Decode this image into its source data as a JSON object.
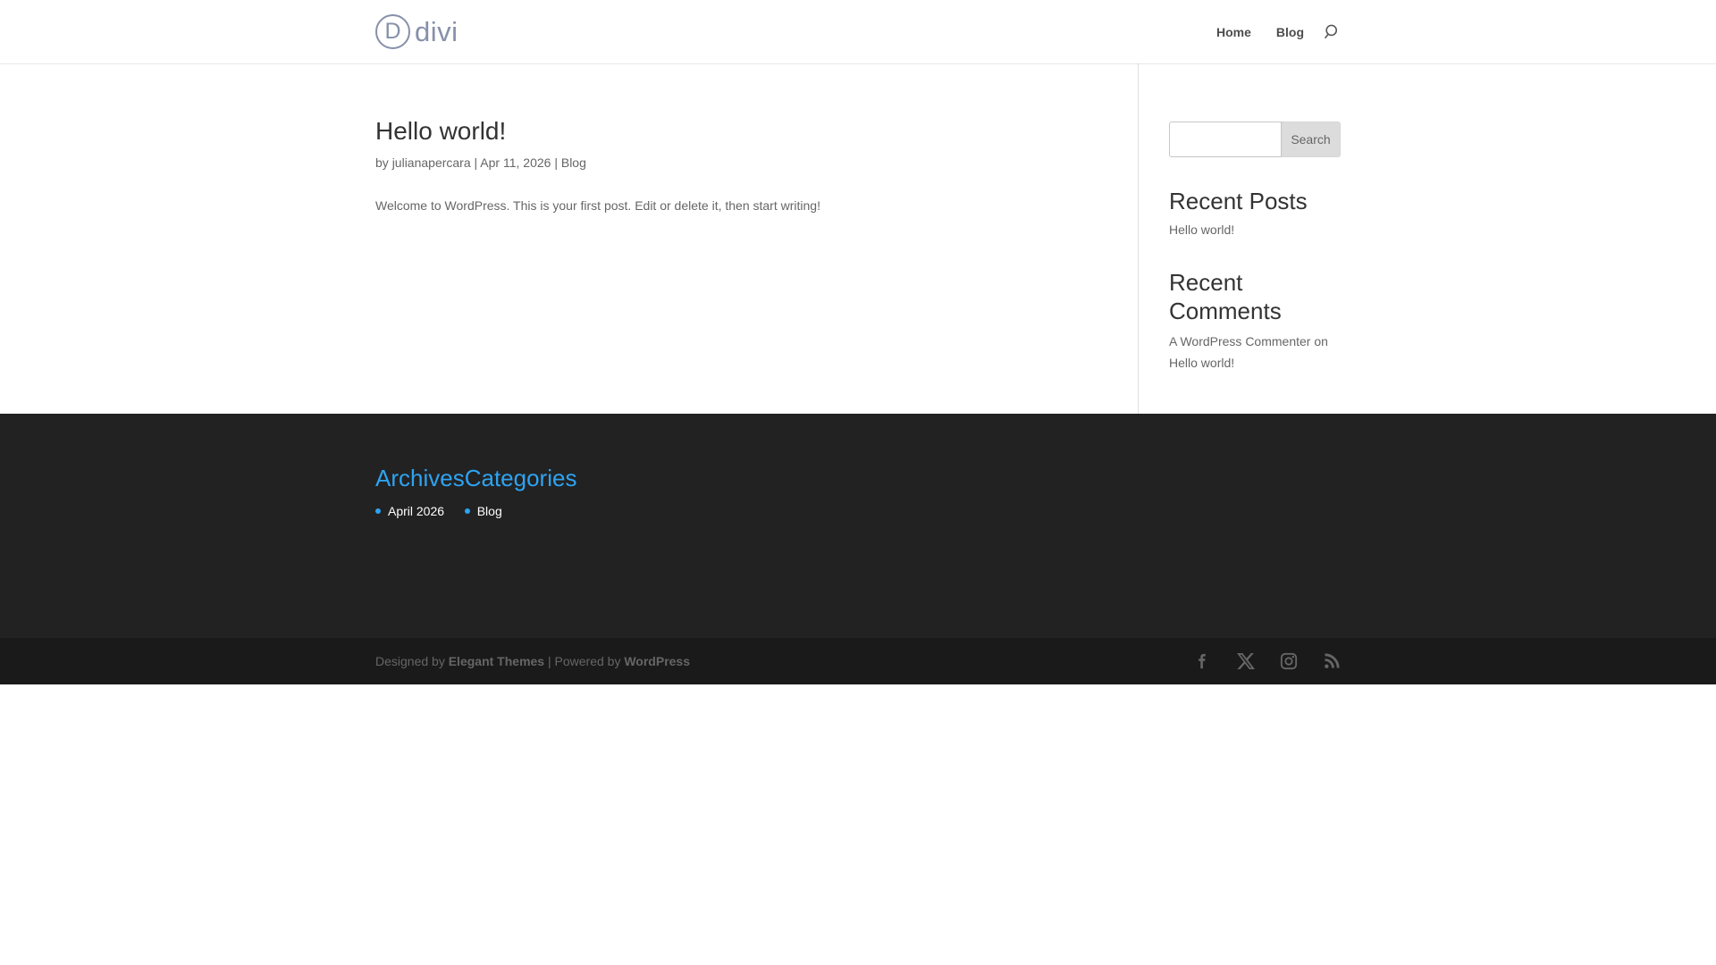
{
  "header": {
    "logo": {
      "circle_letter": "D",
      "wordmark": "divi"
    },
    "nav": [
      {
        "label": "Home"
      },
      {
        "label": "Blog"
      }
    ],
    "search_icon": "search-icon"
  },
  "post": {
    "title": "Hello world!",
    "meta": {
      "by_label": "by ",
      "author": "julianapercara",
      "sep1": " | ",
      "date": "Apr 11, 2026",
      "sep2": " | ",
      "category": "Blog"
    },
    "body": "Welcome to WordPress. This is your first post. Edit or delete it, then start writing!"
  },
  "sidebar": {
    "search": {
      "placeholder": "",
      "button_label": "Search"
    },
    "recent_posts": {
      "title": "Recent Posts",
      "items": [
        "Hello world!"
      ]
    },
    "recent_comments": {
      "title": "Recent Comments",
      "items": [
        {
          "author": "A WordPress Commenter",
          "on_label": " on ",
          "post": "Hello world!"
        }
      ]
    }
  },
  "footer": {
    "widgets": [
      {
        "title": "Archives",
        "items": [
          "April 2026"
        ]
      },
      {
        "title": "Categories",
        "items": [
          "Blog"
        ]
      }
    ],
    "bottom": {
      "designed_by": "Designed by ",
      "theme_link": "Elegant Themes",
      "powered_by": " | Powered by ",
      "wp_link": "WordPress",
      "social": [
        "facebook-icon",
        "x-icon",
        "instagram-icon",
        "rss-icon"
      ]
    }
  },
  "colors": {
    "accent_blue": "#2ea3f2",
    "logo_gray_blue": "#8690aa",
    "footer_bg": "#222222",
    "bottom_bar_bg": "#1a1a1a",
    "text_dark": "#333333",
    "text_gray": "#666666"
  }
}
